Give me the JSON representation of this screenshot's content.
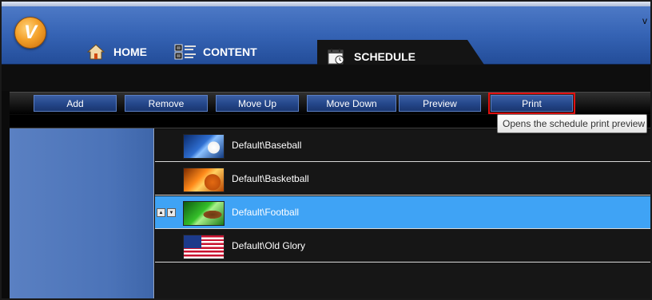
{
  "app": {
    "logo_letter": "V",
    "window_chevron": "v"
  },
  "nav": {
    "tabs": [
      {
        "label": "HOME",
        "icon": "home-icon"
      },
      {
        "label": "CONTENT",
        "icon": "content-icon"
      },
      {
        "label": "SCHEDULE",
        "icon": "schedule-icon",
        "active": true
      }
    ]
  },
  "toolbar": {
    "add_label": "Add",
    "remove_label": "Remove",
    "move_up_label": "Move Up",
    "move_down_label": "Move Down",
    "preview_label": "Preview",
    "print_label": "Print"
  },
  "tooltip": {
    "text": "Opens the schedule print preview"
  },
  "schedule": {
    "items": [
      {
        "label": "Default\\Baseball",
        "thumb": "baseball",
        "selected": false
      },
      {
        "label": "Default\\Basketball",
        "thumb": "basketball",
        "selected": false
      },
      {
        "label": "Default\\Football",
        "thumb": "football",
        "selected": true
      },
      {
        "label": "Default\\Old Glory",
        "thumb": "old-glory-flag",
        "selected": false
      }
    ]
  },
  "colors": {
    "header_blue": "#3563b4",
    "selected_row": "#3fa3f5",
    "button_blue": "#244689",
    "print_highlight": "#e01010"
  }
}
